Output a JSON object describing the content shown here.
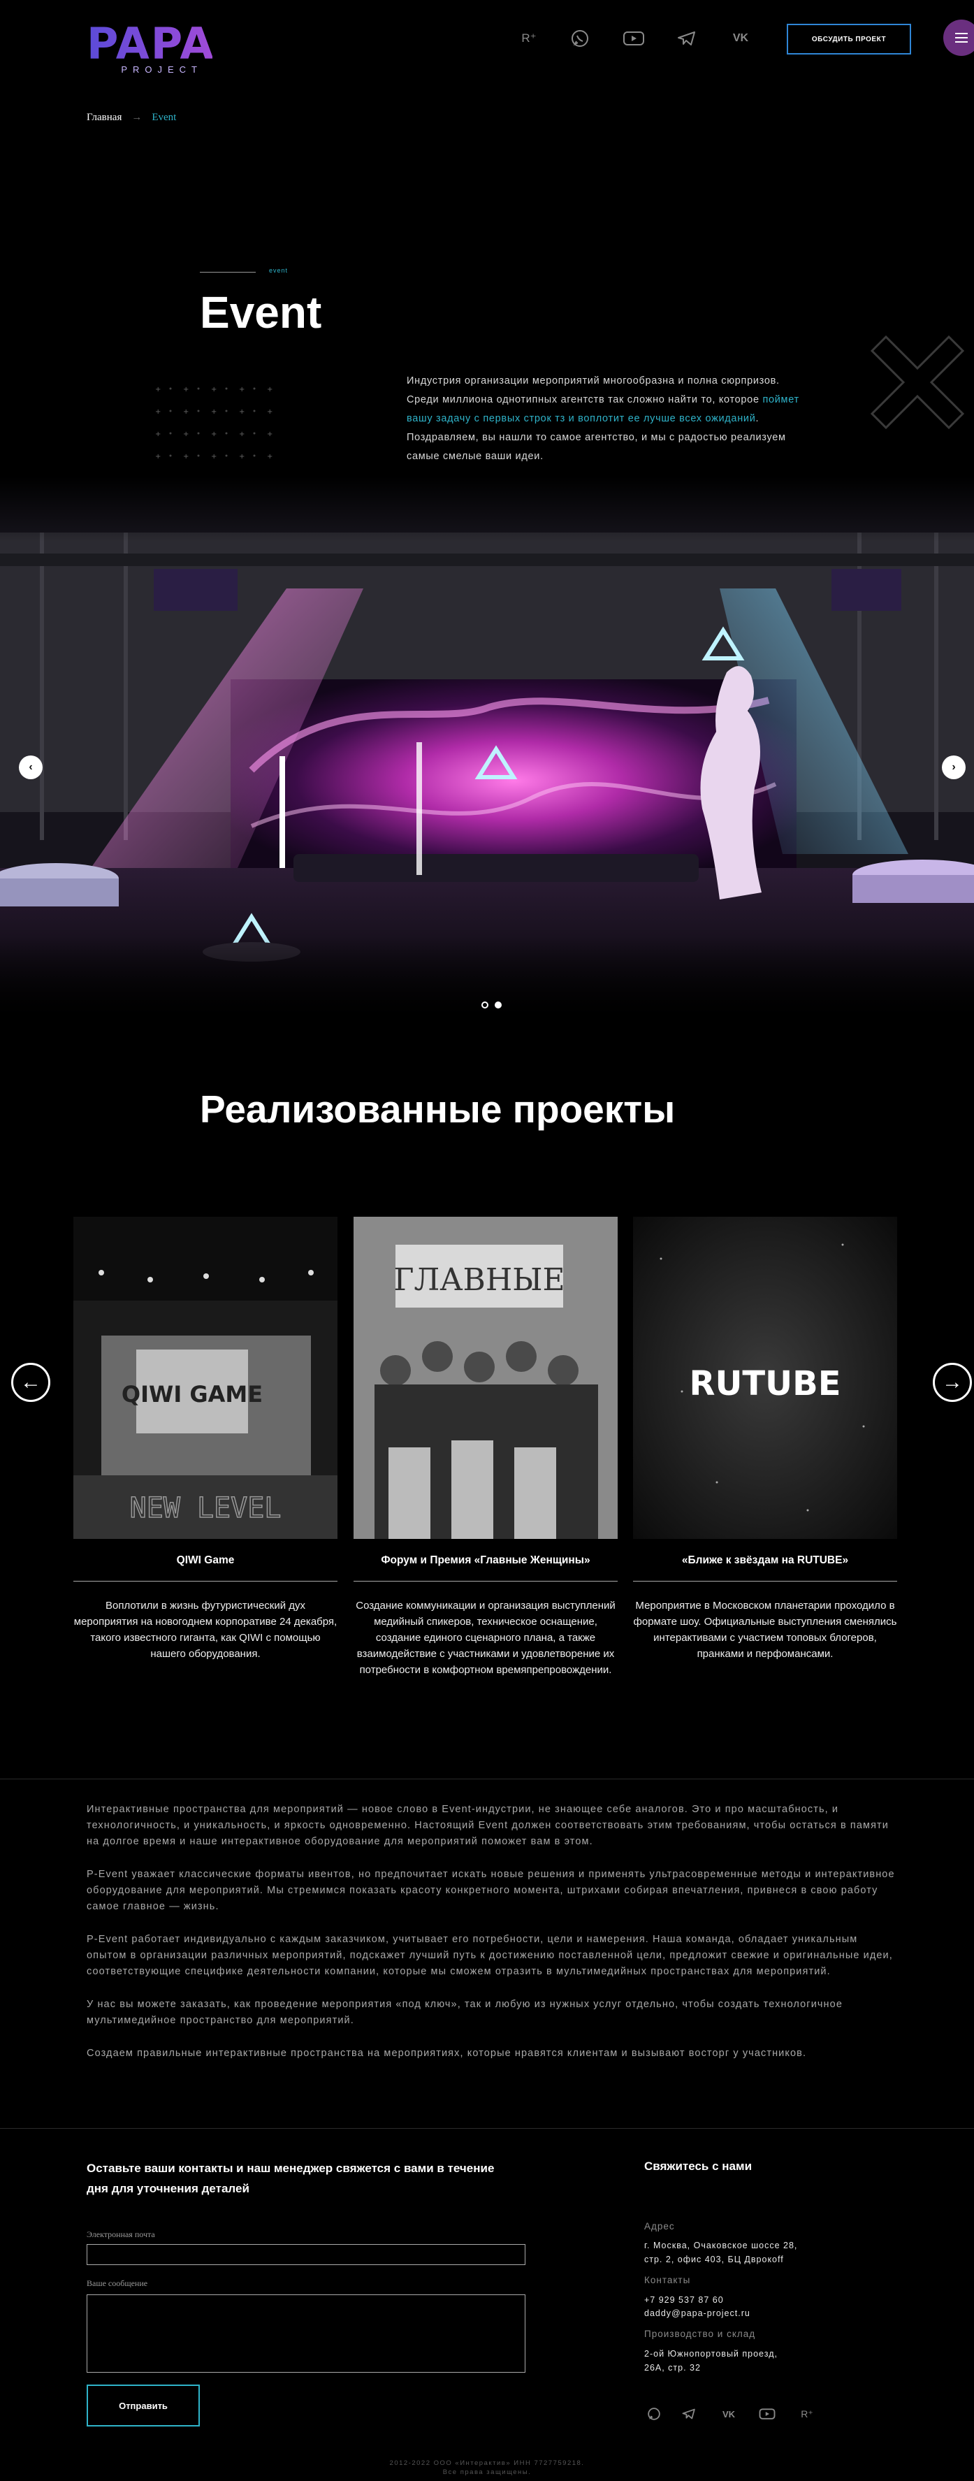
{
  "header": {
    "logo_main": "PAPA",
    "logo_sub": "PROJECT",
    "icons": [
      "rutube-icon",
      "whatsapp-icon",
      "youtube-icon",
      "telegram-icon",
      "vk-icon"
    ],
    "icon_glyphs": {
      "rutube": "R⁺",
      "whatsapp": "✆",
      "youtube": "▶",
      "telegram": "➤",
      "vk": "VK"
    },
    "cta_label": "ОБСУДИТЬ ПРОЕКТ"
  },
  "breadcrumb": {
    "home": "Главная",
    "separator": "→",
    "current": "Event"
  },
  "hero": {
    "eyebrow": "event",
    "title": "Event",
    "intro_before": "Индустрия организации мероприятий многообразна и полна сюрпризов. Среди миллиона однотипных агентств так сложно найти то, которое ",
    "intro_highlight": "поймет вашу задачу с первых строк тз и воплотит ее лучше всех ожиданий",
    "intro_after": ". Поздравляем, вы нашли то самое агентство, и мы с радостью реализуем самые смелые ваши идеи."
  },
  "slider": {
    "prev": "‹",
    "next": "›",
    "slides_count": 2,
    "active_index": 1
  },
  "projects": {
    "title": "Реализованные проекты",
    "prev": "←",
    "next": "→",
    "cards": [
      {
        "title": "QIWI Game",
        "image_text": "QIWI GAME",
        "image_sub": "NEW LEVEL",
        "description": "Воплотили в жизнь футуристический дух мероприятия на новогоднем корпоративе 24 декабря, такого известного гиганта, как QIWI с помощью нашего оборудования."
      },
      {
        "title": "Форум и Премия «Главные Женщины»",
        "image_text": "ГЛАВНЫЕ",
        "description": "Создание коммуникации и организация выступлений медийный спикеров, техническое оснащение, создание единого сценарного плана, а также взаимодействие с участниками и удовлетворение их потребности в комфортном времяпрепровождении."
      },
      {
        "title": "«Ближе к звёздам на RUTUBE»",
        "image_text": "RUTUBE",
        "description": "Мероприятие в Московском планетарии проходило в формате шоу. Официальные выступления сменялись интерактивами с участием топовых блогеров, пранками и перфомансами."
      }
    ]
  },
  "seo_text": [
    "Интерактивные пространства для мероприятий — новое слово в Event-индустрии, не знающее себе аналогов. Это и про масштабность, и технологичность, и уникальность, и яркость одновременно. Настоящий Event должен соответствовать этим требованиям, чтобы остаться в памяти на долгое время и наше интерактивное оборудование для мероприятий поможет вам в этом.",
    "P-Event уважает классические форматы ивентов, но предпочитает искать новые решения и применять ультрасовременные методы и интерактивное оборудование для мероприятий. Мы стремимся показать красоту конкретного момента, штрихами собирая впечатления, привнеся в свою работу самое главное — жизнь.",
    "P-Event работает индивидуально с каждым заказчиком, учитывает его потребности, цели и намерения. Наша команда, обладает уникальным опытом в организации различных мероприятий, подскажет лучший путь к достижению поставленной цели, предложит свежие и оригинальные идеи, соответствующие специфике деятельности компании, которые мы сможем отразить в мультимедийных пространствах для мероприятий.",
    "У нас вы можете заказать, как проведение мероприятия «под ключ», так и любую из нужных услуг отдельно, чтобы создать технологичное мультимедийное пространство для мероприятий.",
    "Создаем правильные интерактивные пространства на мероприятиях, которые нравятся клиентам и вызывают восторг у участников."
  ],
  "form": {
    "title": "Оставьте ваши контакты и наш менеджер свяжется с вами в течение дня для уточнения деталей",
    "email_label": "Электронная почта",
    "email_value": "",
    "message_label": "Ваше сообщение",
    "message_value": "",
    "submit_label": "Отправить"
  },
  "contacts": {
    "title": "Свяжитесь с нами",
    "address_label": "Адрес",
    "address_line1": "г. Москва, Очаковское шоссе 28,",
    "address_line2": "стр. 2, офис 403, БЦ Дврокоff",
    "contacts_label": "Контакты",
    "phone": "+7 929 537 87 60",
    "email": "daddy@papa-project.ru",
    "production_label": "Производство и склад",
    "production_line1": "2-ой Южнопортовый проезд,",
    "production_line2": "26А, стр. 32"
  },
  "footer": {
    "icons": [
      "whatsapp-icon",
      "telegram-icon",
      "vk-icon",
      "youtube-icon",
      "rutube-icon"
    ],
    "copyright_line1": "2012-2022 ООО «Интерактив» ИНН 7727759218.",
    "copyright_line2": "Все права защищены."
  },
  "colors": {
    "accent": "#2fb3c9",
    "cta_border": "#2f86d6",
    "brand_purple": "#6a2f7f",
    "background": "#000000"
  }
}
